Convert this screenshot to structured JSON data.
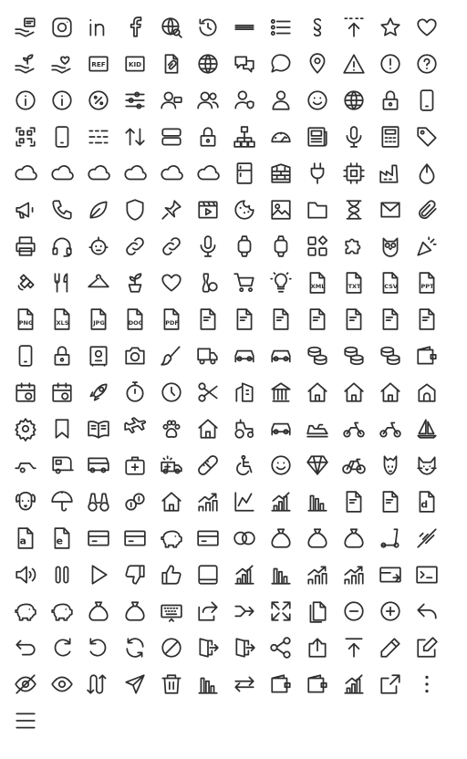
{
  "style": {
    "stroke_color": "#2f2f2f",
    "background": "#ffffff"
  },
  "icons": [
    {
      "name": "hand-message",
      "glyph": "hand-message"
    },
    {
      "name": "instagram",
      "glyph": "instagram"
    },
    {
      "name": "linkedin",
      "glyph": "linkedin"
    },
    {
      "name": "facebook",
      "glyph": "facebook"
    },
    {
      "name": "globe-search",
      "glyph": "globe-search"
    },
    {
      "name": "history",
      "glyph": "history"
    },
    {
      "name": "triple-line",
      "glyph": "triple-line"
    },
    {
      "name": "list",
      "glyph": "list"
    },
    {
      "name": "section",
      "glyph": "section"
    },
    {
      "name": "arrow-up-dashed",
      "glyph": "arrow-up-dashed"
    },
    {
      "name": "star",
      "glyph": "star"
    },
    {
      "name": "heart",
      "glyph": "heart"
    },
    {
      "name": "hand-plant",
      "glyph": "hand-plant"
    },
    {
      "name": "hand-heart",
      "glyph": "hand-heart"
    },
    {
      "name": "ref-badge",
      "glyph": "badge",
      "text": "REF"
    },
    {
      "name": "kid-badge",
      "glyph": "badge",
      "text": "KID"
    },
    {
      "name": "document-attach",
      "glyph": "document-attach"
    },
    {
      "name": "globe",
      "glyph": "globe"
    },
    {
      "name": "chat-bubbles",
      "glyph": "chat-bubbles"
    },
    {
      "name": "chat-bubble",
      "glyph": "chat-bubble"
    },
    {
      "name": "location-pin",
      "glyph": "location-pin"
    },
    {
      "name": "warning",
      "glyph": "warning"
    },
    {
      "name": "info-exclaim",
      "glyph": "circle-exclaim"
    },
    {
      "name": "help",
      "glyph": "circle-question"
    },
    {
      "name": "info-outline",
      "glyph": "circle-info"
    },
    {
      "name": "info",
      "glyph": "circle-info"
    },
    {
      "name": "percent",
      "glyph": "circle-percent"
    },
    {
      "name": "sliders",
      "glyph": "sliders"
    },
    {
      "name": "user-chat",
      "glyph": "user-chat"
    },
    {
      "name": "users",
      "glyph": "users"
    },
    {
      "name": "user-shield",
      "glyph": "user-shield"
    },
    {
      "name": "user",
      "glyph": "user"
    },
    {
      "name": "smiley-face",
      "glyph": "smiley"
    },
    {
      "name": "earth",
      "glyph": "globe"
    },
    {
      "name": "lock-eye",
      "glyph": "lock"
    },
    {
      "name": "phone-dashed",
      "glyph": "phone-dashed"
    },
    {
      "name": "qr-code",
      "glyph": "qr"
    },
    {
      "name": "phone-qr",
      "glyph": "phone-dashed"
    },
    {
      "name": "dash-lines",
      "glyph": "dash-lines"
    },
    {
      "name": "sort",
      "glyph": "sort"
    },
    {
      "name": "stack",
      "glyph": "stack"
    },
    {
      "name": "unlock",
      "glyph": "lock"
    },
    {
      "name": "hierarchy",
      "glyph": "hierarchy"
    },
    {
      "name": "speedometer",
      "glyph": "speedometer"
    },
    {
      "name": "newspaper",
      "glyph": "newspaper"
    },
    {
      "name": "microphone",
      "glyph": "microphone"
    },
    {
      "name": "calculator",
      "glyph": "calculator"
    },
    {
      "name": "tag",
      "glyph": "tag"
    },
    {
      "name": "cloud-rain",
      "glyph": "cloud"
    },
    {
      "name": "cloud-sync",
      "glyph": "cloud"
    },
    {
      "name": "cloud-upload",
      "glyph": "cloud"
    },
    {
      "name": "cloud-download",
      "glyph": "cloud"
    },
    {
      "name": "cloud-transfer",
      "glyph": "cloud"
    },
    {
      "name": "cloud",
      "glyph": "cloud"
    },
    {
      "name": "fridge",
      "glyph": "fridge"
    },
    {
      "name": "firewall",
      "glyph": "firewall"
    },
    {
      "name": "plug",
      "glyph": "plug"
    },
    {
      "name": "cpu",
      "glyph": "cpu"
    },
    {
      "name": "factory",
      "glyph": "factory"
    },
    {
      "name": "drop",
      "glyph": "drop"
    },
    {
      "name": "megaphone",
      "glyph": "megaphone"
    },
    {
      "name": "phone",
      "glyph": "phone"
    },
    {
      "name": "leaf",
      "glyph": "leaf"
    },
    {
      "name": "shield",
      "glyph": "shield"
    },
    {
      "name": "pin",
      "glyph": "pin"
    },
    {
      "name": "video-play",
      "glyph": "video"
    },
    {
      "name": "cookie",
      "glyph": "cookie"
    },
    {
      "name": "image",
      "glyph": "image"
    },
    {
      "name": "folder",
      "glyph": "folder"
    },
    {
      "name": "hourglass",
      "glyph": "hourglass"
    },
    {
      "name": "mail",
      "glyph": "mail"
    },
    {
      "name": "paperclip",
      "glyph": "paperclip"
    },
    {
      "name": "printer",
      "glyph": "printer"
    },
    {
      "name": "headset",
      "glyph": "headset"
    },
    {
      "name": "robot",
      "glyph": "robot"
    },
    {
      "name": "link-broken",
      "glyph": "link"
    },
    {
      "name": "link",
      "glyph": "link"
    },
    {
      "name": "microphone-2",
      "glyph": "microphone"
    },
    {
      "name": "watch",
      "glyph": "watch"
    },
    {
      "name": "smartwatch",
      "glyph": "watch"
    },
    {
      "name": "widgets",
      "glyph": "widgets"
    },
    {
      "name": "puzzle",
      "glyph": "puzzle"
    },
    {
      "name": "owl",
      "glyph": "owl"
    },
    {
      "name": "party-popper",
      "glyph": "party"
    },
    {
      "name": "satellite",
      "glyph": "satellite"
    },
    {
      "name": "cutlery",
      "glyph": "cutlery"
    },
    {
      "name": "hanger",
      "glyph": "hanger"
    },
    {
      "name": "plant-pot",
      "glyph": "plant"
    },
    {
      "name": "heart-pulse",
      "glyph": "heart"
    },
    {
      "name": "bowling",
      "glyph": "bowling"
    },
    {
      "name": "shopping-cart",
      "glyph": "cart"
    },
    {
      "name": "lightbulb",
      "glyph": "bulb"
    },
    {
      "name": "xml-file",
      "glyph": "file-text",
      "text": "XML"
    },
    {
      "name": "txt-file",
      "glyph": "file-text",
      "text": "TXT"
    },
    {
      "name": "csv-file",
      "glyph": "file-text",
      "text": "CSV"
    },
    {
      "name": "ppt-file",
      "glyph": "file-text",
      "text": "PPT"
    },
    {
      "name": "png-file",
      "glyph": "file-text",
      "text": "PNG"
    },
    {
      "name": "xls-file",
      "glyph": "file-text",
      "text": "XLS"
    },
    {
      "name": "jpg-file",
      "glyph": "file-text",
      "text": "JPG"
    },
    {
      "name": "doc-file",
      "glyph": "file-text",
      "text": "DOC"
    },
    {
      "name": "pdf-file",
      "glyph": "file-text",
      "text": "PDF"
    },
    {
      "name": "document-award",
      "glyph": "file"
    },
    {
      "name": "document-warning",
      "glyph": "file"
    },
    {
      "name": "document-search",
      "glyph": "file"
    },
    {
      "name": "document-remove",
      "glyph": "file"
    },
    {
      "name": "document-edit",
      "glyph": "file"
    },
    {
      "name": "document-add",
      "glyph": "file"
    },
    {
      "name": "document",
      "glyph": "file"
    },
    {
      "name": "smartphone",
      "glyph": "phone-dashed"
    },
    {
      "name": "lock-closed",
      "glyph": "lock"
    },
    {
      "name": "safe",
      "glyph": "safe"
    },
    {
      "name": "camera",
      "glyph": "camera"
    },
    {
      "name": "brush",
      "glyph": "brush"
    },
    {
      "name": "truck",
      "glyph": "truck"
    },
    {
      "name": "car",
      "glyph": "car"
    },
    {
      "name": "car-front",
      "glyph": "car"
    },
    {
      "name": "coins-hand",
      "glyph": "coins"
    },
    {
      "name": "coins",
      "glyph": "coins"
    },
    {
      "name": "coins-stack",
      "glyph": "coins"
    },
    {
      "name": "wallet",
      "glyph": "wallet"
    },
    {
      "name": "calendar-sync",
      "glyph": "calendar"
    },
    {
      "name": "calendar-cancel",
      "glyph": "calendar"
    },
    {
      "name": "rocket",
      "glyph": "rocket"
    },
    {
      "name": "stopwatch",
      "glyph": "stopwatch"
    },
    {
      "name": "clock",
      "glyph": "clock"
    },
    {
      "name": "scissors",
      "glyph": "scissors"
    },
    {
      "name": "building",
      "glyph": "building"
    },
    {
      "name": "bank",
      "glyph": "bank"
    },
    {
      "name": "house-kr",
      "glyph": "house"
    },
    {
      "name": "house-heat",
      "glyph": "house"
    },
    {
      "name": "house",
      "glyph": "house"
    },
    {
      "name": "house-outline",
      "glyph": "house-round"
    },
    {
      "name": "settings",
      "glyph": "gear"
    },
    {
      "name": "bookmark",
      "glyph": "bookmark"
    },
    {
      "name": "book-open",
      "glyph": "book"
    },
    {
      "name": "airplane",
      "glyph": "plane"
    },
    {
      "name": "paw",
      "glyph": "paw"
    },
    {
      "name": "house-tools",
      "glyph": "house"
    },
    {
      "name": "tractor",
      "glyph": "tractor"
    },
    {
      "name": "golf-cart",
      "glyph": "car"
    },
    {
      "name": "jetski",
      "glyph": "jetski"
    },
    {
      "name": "motorcycle",
      "glyph": "motorcycle"
    },
    {
      "name": "scooter",
      "glyph": "motorcycle"
    },
    {
      "name": "sailboat",
      "glyph": "sailboat"
    },
    {
      "name": "trailer",
      "glyph": "trailer"
    },
    {
      "name": "caravan",
      "glyph": "caravan"
    },
    {
      "name": "camper-van",
      "glyph": "camper"
    },
    {
      "name": "first-aid-kit",
      "glyph": "firstaid"
    },
    {
      "name": "ambulance",
      "glyph": "ambulance"
    },
    {
      "name": "bandage",
      "glyph": "bandage"
    },
    {
      "name": "wheelchair",
      "glyph": "wheelchair"
    },
    {
      "name": "baby",
      "glyph": "smiley"
    },
    {
      "name": "diamond",
      "glyph": "diamond"
    },
    {
      "name": "bicycle",
      "glyph": "bicycle"
    },
    {
      "name": "horse",
      "glyph": "horse"
    },
    {
      "name": "cat",
      "glyph": "cat"
    },
    {
      "name": "dog",
      "glyph": "dog"
    },
    {
      "name": "umbrella",
      "glyph": "umbrella"
    },
    {
      "name": "binoculars",
      "glyph": "binoculars"
    },
    {
      "name": "currency-exchange",
      "glyph": "exchange"
    },
    {
      "name": "house-money",
      "glyph": "house"
    },
    {
      "name": "investment-growth",
      "glyph": "growth"
    },
    {
      "name": "chart-line",
      "glyph": "chartline"
    },
    {
      "name": "chart-bar-up",
      "glyph": "bars-up"
    },
    {
      "name": "chart-bar-down",
      "glyph": "bars-down"
    },
    {
      "name": "document-undo",
      "glyph": "file"
    },
    {
      "name": "document-delete",
      "glyph": "file"
    },
    {
      "name": "document-d",
      "glyph": "file-letter",
      "text": "d"
    },
    {
      "name": "document-a",
      "glyph": "file-letter",
      "text": "a"
    },
    {
      "name": "document-e",
      "glyph": "file-letter",
      "text": "e"
    },
    {
      "name": "card-lock",
      "glyph": "card"
    },
    {
      "name": "credit-card",
      "glyph": "card"
    },
    {
      "name": "piggy-bank",
      "glyph": "piggy"
    },
    {
      "name": "payment-card",
      "glyph": "card"
    },
    {
      "name": "rings",
      "glyph": "rings"
    },
    {
      "name": "money-bag-percent",
      "glyph": "moneybag"
    },
    {
      "name": "money-bag-card",
      "glyph": "moneybag"
    },
    {
      "name": "money-bag-kr",
      "glyph": "moneybag"
    },
    {
      "name": "kick-scooter",
      "glyph": "kickscooter"
    },
    {
      "name": "no-connection",
      "glyph": "nolink"
    },
    {
      "name": "volume",
      "glyph": "volume"
    },
    {
      "name": "pause",
      "glyph": "pause"
    },
    {
      "name": "play",
      "glyph": "play"
    },
    {
      "name": "thumb-down",
      "glyph": "thumbdown"
    },
    {
      "name": "thumb-up",
      "glyph": "thumbup"
    },
    {
      "name": "tablet",
      "glyph": "tablet"
    },
    {
      "name": "chart-transfer",
      "glyph": "bars-up"
    },
    {
      "name": "chart-exchange",
      "glyph": "bars-down"
    },
    {
      "name": "chart-growth-arrow",
      "glyph": "growth"
    },
    {
      "name": "chart-arrow-up",
      "glyph": "growth"
    },
    {
      "name": "card-transfer",
      "glyph": "cardarrow"
    },
    {
      "name": "terminal",
      "glyph": "terminal"
    },
    {
      "name": "piggy-bank-in",
      "glyph": "piggy"
    },
    {
      "name": "piggy-bank-out",
      "glyph": "piggy"
    },
    {
      "name": "money-bag-transfer",
      "glyph": "moneybag"
    },
    {
      "name": "money-bag-exchange",
      "glyph": "moneybag"
    },
    {
      "name": "keyboard",
      "glyph": "keyboard"
    },
    {
      "name": "share-box",
      "glyph": "sharebox"
    },
    {
      "name": "merge",
      "glyph": "merge"
    },
    {
      "name": "fullscreen",
      "glyph": "fullscreen"
    },
    {
      "name": "copy",
      "glyph": "copy"
    },
    {
      "name": "minus-circle",
      "glyph": "minuscircle"
    },
    {
      "name": "plus-circle",
      "glyph": "pluscircle"
    },
    {
      "name": "reply",
      "glyph": "reply"
    },
    {
      "name": "return",
      "glyph": "return"
    },
    {
      "name": "redo",
      "glyph": "redo"
    },
    {
      "name": "undo",
      "glyph": "undo"
    },
    {
      "name": "refresh",
      "glyph": "refresh"
    },
    {
      "name": "forbidden",
      "glyph": "forbidden"
    },
    {
      "name": "logout",
      "glyph": "door"
    },
    {
      "name": "login",
      "glyph": "door"
    },
    {
      "name": "share-nodes",
      "glyph": "sharenodes"
    },
    {
      "name": "upload",
      "glyph": "uploadbox"
    },
    {
      "name": "arrow-up-bar",
      "glyph": "arrowupbar"
    },
    {
      "name": "pencil",
      "glyph": "pencil"
    },
    {
      "name": "edit-box",
      "glyph": "editbox"
    },
    {
      "name": "eye-off",
      "glyph": "eyeoff"
    },
    {
      "name": "eye",
      "glyph": "eye"
    },
    {
      "name": "swap-vertical",
      "glyph": "swapvert"
    },
    {
      "name": "send",
      "glyph": "send"
    },
    {
      "name": "trash",
      "glyph": "trash"
    },
    {
      "name": "chart-decline",
      "glyph": "bars-down"
    },
    {
      "name": "swap-horizontal",
      "glyph": "swaphoriz"
    },
    {
      "name": "wallet-in",
      "glyph": "wallet"
    },
    {
      "name": "wallet-out",
      "glyph": "wallet"
    },
    {
      "name": "chart-rise",
      "glyph": "bars-up"
    },
    {
      "name": "external-link",
      "glyph": "external"
    },
    {
      "name": "more-vertical",
      "glyph": "morevert"
    },
    {
      "name": "menu",
      "glyph": "menu"
    }
  ]
}
